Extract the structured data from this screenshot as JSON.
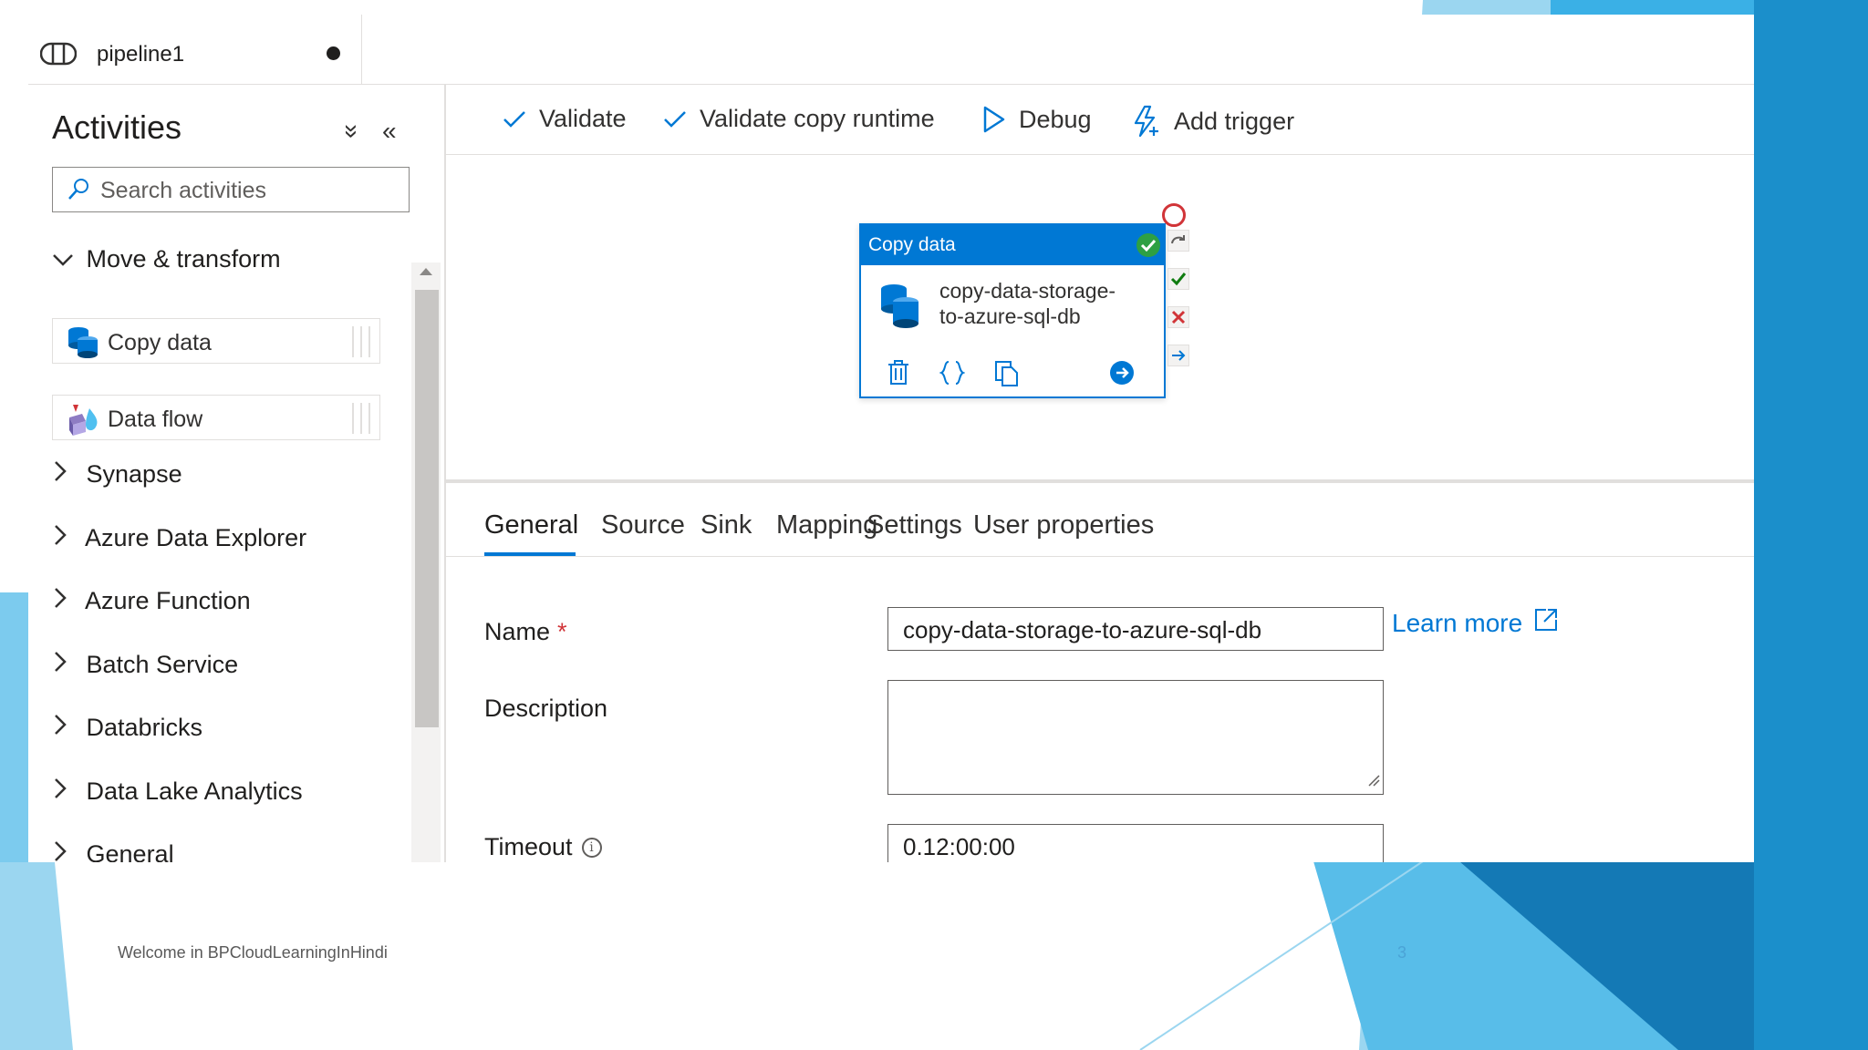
{
  "pipeline_tab": {
    "title": "pipeline1"
  },
  "activities": {
    "title": "Activities",
    "collapse_all_glyph": "»",
    "hide_glyph": "«",
    "search_placeholder": "Search activities",
    "expanded_group": "Move & transform",
    "items": [
      {
        "label": "Copy data",
        "icon": "copy-data-icon"
      },
      {
        "label": "Data flow",
        "icon": "data-flow-icon"
      }
    ],
    "groups": [
      "Synapse",
      "Azure Data Explorer",
      "Azure Function",
      "Batch Service",
      "Databricks",
      "Data Lake Analytics",
      "General"
    ]
  },
  "toolbar": {
    "validate": "Validate",
    "validate_copy_runtime": "Validate copy runtime",
    "debug": "Debug",
    "add_trigger": "Add trigger"
  },
  "canvas": {
    "node": {
      "header": "Copy data",
      "name_line1": "copy-data-storage-",
      "name_line2": "to-azure-sql-db"
    }
  },
  "properties": {
    "tabs": [
      "General",
      "Source",
      "Sink",
      "Mapping",
      "Settings",
      "User properties"
    ],
    "active_tab": "General",
    "name_label": "Name",
    "required_mark": "*",
    "name_value": "copy-data-storage-to-azure-sql-db",
    "learn_more": "Learn more",
    "description_label": "Description",
    "description_value": "",
    "timeout_label": "Timeout",
    "info_glyph": "i",
    "timeout_value": "0.12:00:00"
  },
  "slide": {
    "footer": "Welcome in BPCloudLearningInHindi",
    "page_number": "3"
  },
  "colors": {
    "accent": "#0078d4",
    "success": "#2ea043",
    "error": "#d13438",
    "slide_blue": "#1e9ad6"
  }
}
